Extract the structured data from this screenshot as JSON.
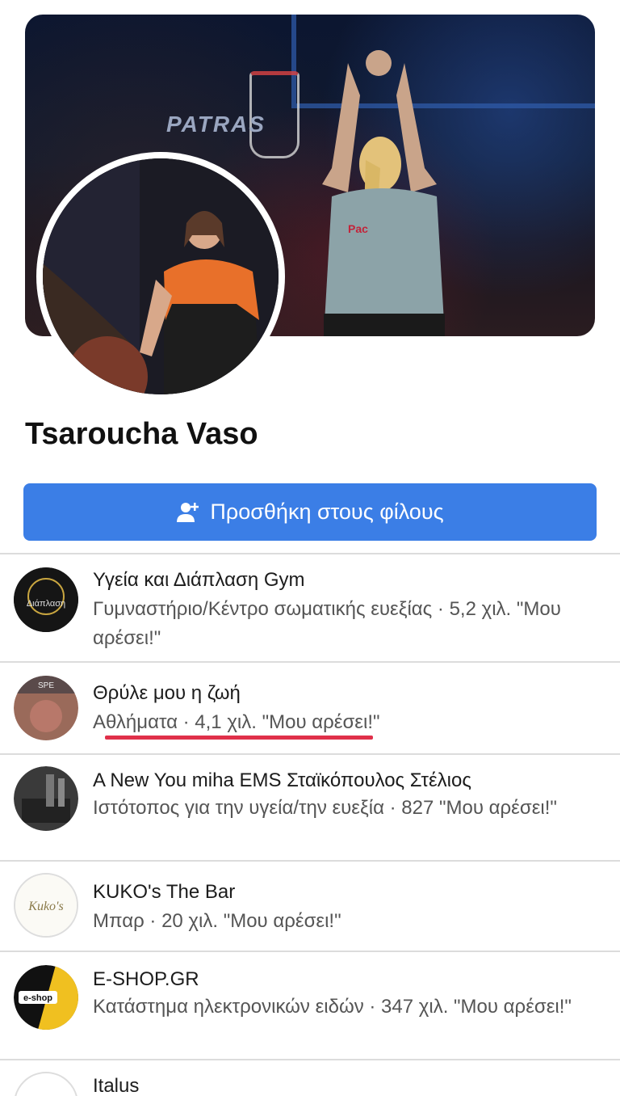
{
  "profile": {
    "name": "Tsaroucha Vaso",
    "add_friend_label": "Προσθήκη στους φίλους",
    "cover_banner_text": "PATRAS"
  },
  "pages": [
    {
      "title": "Υγεία και Διάπλαση Gym",
      "subtitle": "Γυμναστήριο/Κέντρο σωματικής ευεξίας · 5,2 χιλ. \"Μου αρέσει!\"",
      "logo_text": "Διάπλαση"
    },
    {
      "title": "Θρύλε μου η ζωή",
      "subtitle": "Αθλήματα · 4,1 χιλ. \"Μου αρέσει!\"",
      "logo_text": "SPE"
    },
    {
      "title": "A New You miha EMS Σταϊκόπουλος Στέλιος",
      "subtitle": "Ιστότοπος για την υγεία/την ευεξία · 827 \"Μου αρέσει!\"",
      "logo_text": ""
    },
    {
      "title": "KUKO's The Bar",
      "subtitle": "Μπαρ · 20 χιλ. \"Μου αρέσει!\"",
      "logo_text": "Kuko's"
    },
    {
      "title": "E-SHOP.GR",
      "subtitle": "Κατάστημα ηλεκτρονικών ειδών · 347 χιλ. \"Μου αρέσει!\"",
      "logo_text": "e-shop"
    },
    {
      "title": "Italus",
      "subtitle": "",
      "logo_text": ""
    }
  ],
  "colors": {
    "accent": "#3b7ee6",
    "highlight_underline": "#e0304a"
  }
}
